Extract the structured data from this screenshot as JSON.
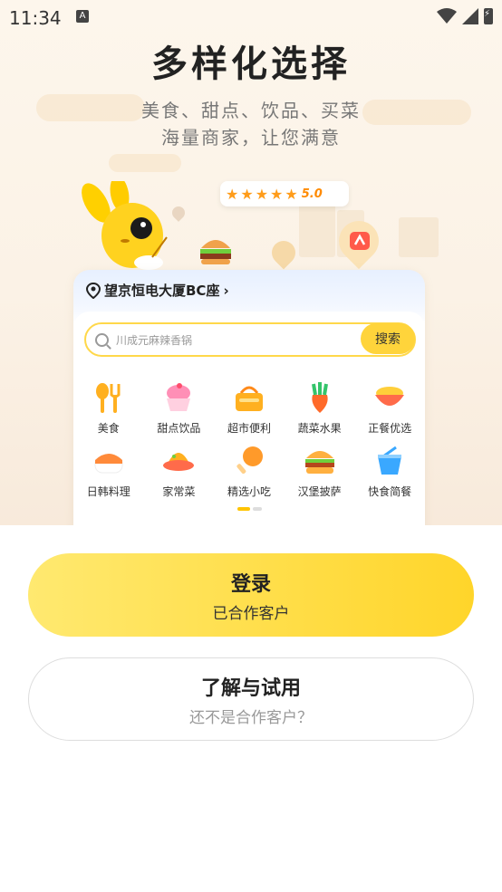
{
  "status_bar": {
    "time": "11:34",
    "notify_letter": "A"
  },
  "hero": {
    "title": "多样化选择",
    "subtitle_line1": "美食、甜点、饮品、买菜",
    "subtitle_line2": "海量商家，让您满意",
    "rating": {
      "stars": 5,
      "value": "5.0"
    }
  },
  "card": {
    "location": "望京恒电大厦BC座",
    "location_chevron": "›",
    "search": {
      "placeholder": "川成元麻辣香锅",
      "button": "搜索"
    },
    "categories": [
      {
        "label": "美食",
        "icon": "utensils-icon"
      },
      {
        "label": "甜点饮品",
        "icon": "dessert-icon"
      },
      {
        "label": "超市便利",
        "icon": "basket-icon"
      },
      {
        "label": "蔬菜水果",
        "icon": "carrot-icon"
      },
      {
        "label": "正餐优选",
        "icon": "bowl-icon"
      },
      {
        "label": "日韩料理",
        "icon": "sushi-icon"
      },
      {
        "label": "家常菜",
        "icon": "dish-icon"
      },
      {
        "label": "精选小吃",
        "icon": "drumstick-icon"
      },
      {
        "label": "汉堡披萨",
        "icon": "burger-icon"
      },
      {
        "label": "快食简餐",
        "icon": "takeout-icon"
      }
    ]
  },
  "pager": {
    "active_index": 0,
    "count": 2
  },
  "actions": {
    "login": {
      "title": "登录",
      "subtitle": "已合作客户"
    },
    "trial": {
      "title": "了解与试用",
      "subtitle": "还不是合作客户？"
    }
  },
  "colors": {
    "brand_yellow": "#ffd43b",
    "star_orange": "#ff9c1a"
  }
}
